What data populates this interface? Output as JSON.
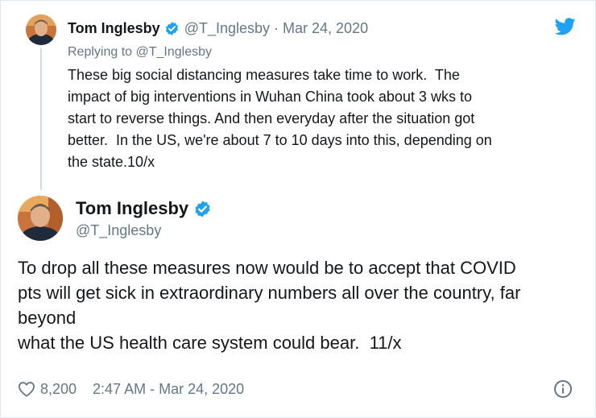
{
  "parent_tweet": {
    "author_name": "Tom Inglesby",
    "handle": "@T_Inglesby",
    "separator": "·",
    "date": "Mar 24, 2020",
    "replying_label": "Replying to",
    "replying_to": "@T_Inglesby",
    "text": "These big social distancing measures take time to work.  The\nimpact of big interventions in Wuhan China took about 3 wks to\nstart to reverse things. And then everyday after the situation got\nbetter.  In the US, we're about 7 to 10 days into this, depending on\nthe state.10/x"
  },
  "main_tweet": {
    "author_name": "Tom Inglesby",
    "handle": "@T_Inglesby",
    "text": "To drop all these measures now would be to accept that COVID\npts will get sick in extraordinary numbers all over the country, far\nbeyond\nwhat the US health care system could bear.  11/x",
    "likes": "8,200",
    "timestamp": "2:47 AM - Mar 24, 2020"
  },
  "icons": {
    "verified": "verified-badge-icon",
    "brand": "twitter-bird-icon",
    "like": "heart-icon",
    "info": "info-icon"
  },
  "colors": {
    "brand_blue": "#1da1f2",
    "text": "#14171a",
    "secondary_text": "#657786",
    "thread_line": "#cfd9de"
  }
}
